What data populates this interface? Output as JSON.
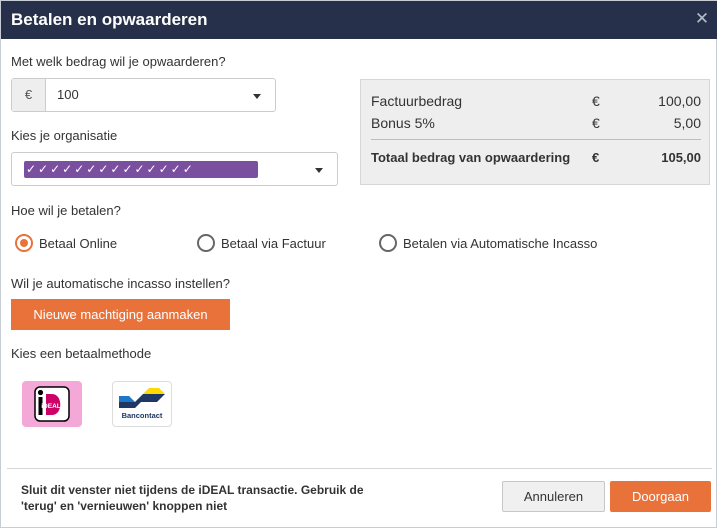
{
  "window": {
    "title": "Betalen en opwaarderen",
    "close_icon": "close-icon"
  },
  "amount": {
    "label": "Met welk bedrag wil je opwaarderen?",
    "currency_symbol": "€",
    "selected_value": "100"
  },
  "organisation": {
    "label": "Kies je organisatie",
    "redacted_value": "✓✓✓✓✓✓✓✓✓✓✓✓✓✓"
  },
  "summary": {
    "rows": [
      {
        "label": "Factuurbedrag",
        "currency": "€",
        "value": "100,00"
      },
      {
        "label": "Bonus 5%",
        "currency": "€",
        "value": "5,00"
      }
    ],
    "total": {
      "label": "Totaal bedrag van opwaardering",
      "currency": "€",
      "value": "105,00"
    }
  },
  "payment": {
    "label": "Hoe wil je betalen?",
    "options": [
      {
        "label": "Betaal Online",
        "checked": true
      },
      {
        "label": "Betaal via Factuur",
        "checked": false
      },
      {
        "label": "Betalen via Automatische Incasso",
        "checked": false
      }
    ]
  },
  "incasso": {
    "label": "Wil je automatische incasso instellen?",
    "button_label": "Nieuwe machtiging aanmaken"
  },
  "methods": {
    "label": "Kies een betaalmethode",
    "items": [
      {
        "name": "iDEAL",
        "logo_text": "iDEAL"
      },
      {
        "name": "Bancontact",
        "logo_text": "Bancontact"
      }
    ]
  },
  "footer": {
    "message": "Sluit dit venster niet tijdens de iDEAL transactie. Gebruik de 'terug' en 'vernieuwen' knoppen niet",
    "cancel_label": "Annuleren",
    "submit_label": "Doorgaan"
  },
  "colors": {
    "titlebar": "#26304a",
    "accent": "#e8723a",
    "redaction": "#7a4fa0",
    "summary_bg": "#eeeeee"
  }
}
